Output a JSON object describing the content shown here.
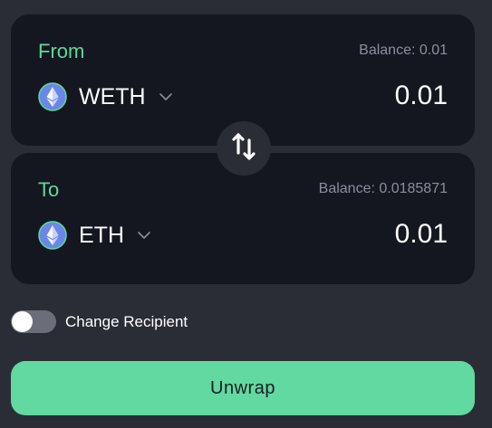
{
  "from": {
    "label": "From",
    "balance": "Balance: 0.01",
    "token_symbol": "WETH",
    "token_icon": "ethereum-icon",
    "amount": "0.01"
  },
  "to": {
    "label": "To",
    "balance": "Balance: 0.0185871",
    "token_symbol": "ETH",
    "token_icon": "ethereum-icon",
    "amount": "0.01"
  },
  "swap_icon": "swap-vertical-icon",
  "recipient": {
    "label": "Change Recipient",
    "enabled": false
  },
  "action": {
    "label": "Unwrap"
  },
  "colors": {
    "background": "#2b2d36",
    "panel": "#141720",
    "accent": "#5ed99a",
    "button": "#61d9a0",
    "muted_text": "#8a8f9c"
  }
}
